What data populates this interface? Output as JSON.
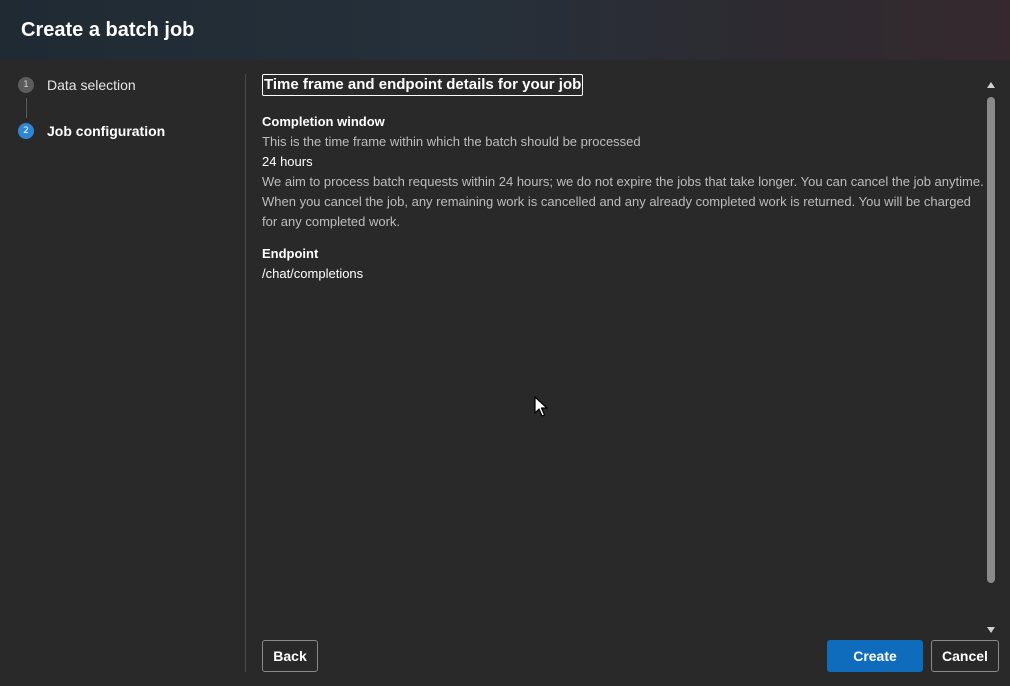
{
  "dialog": {
    "title": "Create a batch job"
  },
  "steps": [
    {
      "number": "1",
      "label": "Data selection",
      "state": "completed"
    },
    {
      "number": "2",
      "label": "Job configuration",
      "state": "active"
    }
  ],
  "content": {
    "section_title": "Time frame and endpoint details for your job",
    "completion_window": {
      "label": "Completion window",
      "description": "This is the time frame within which the batch should be processed",
      "value": "24 hours",
      "note": "We aim to process batch requests within 24 hours; we do not expire the jobs that take longer. You can cancel the job anytime. When you cancel the job, any remaining work is cancelled and any already completed work is returned. You will be charged for any completed work."
    },
    "endpoint": {
      "label": "Endpoint",
      "value": "/chat/completions"
    }
  },
  "footer": {
    "back_label": "Back",
    "create_label": "Create",
    "cancel_label": "Cancel"
  },
  "colors": {
    "background": "#292929",
    "primary": "#0f6cbd",
    "active_step": "#2f86d6"
  },
  "icons": {
    "cursor": "mouse-pointer-icon",
    "scroll_up": "scroll-up-arrow-icon",
    "scroll_down": "scroll-down-arrow-icon"
  }
}
